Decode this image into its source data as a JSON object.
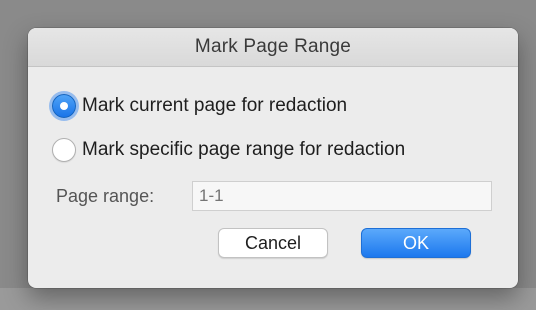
{
  "dialog": {
    "title": "Mark Page Range",
    "options": [
      {
        "label": "Mark current page for redaction",
        "checked": true
      },
      {
        "label": "Mark specific page range for redaction",
        "checked": false
      }
    ],
    "page_range": {
      "label": "Page range:",
      "placeholder": "1-1",
      "value": ""
    },
    "buttons": {
      "cancel_label": "Cancel",
      "ok_label": "OK"
    }
  },
  "colors": {
    "accent": "#1a74e8",
    "dialog_background": "#ececec",
    "backdrop": "#8a8a8a"
  },
  "icons": {
    "radio_checked": "radio-checked-icon",
    "radio_unchecked": "radio-unchecked-icon"
  }
}
